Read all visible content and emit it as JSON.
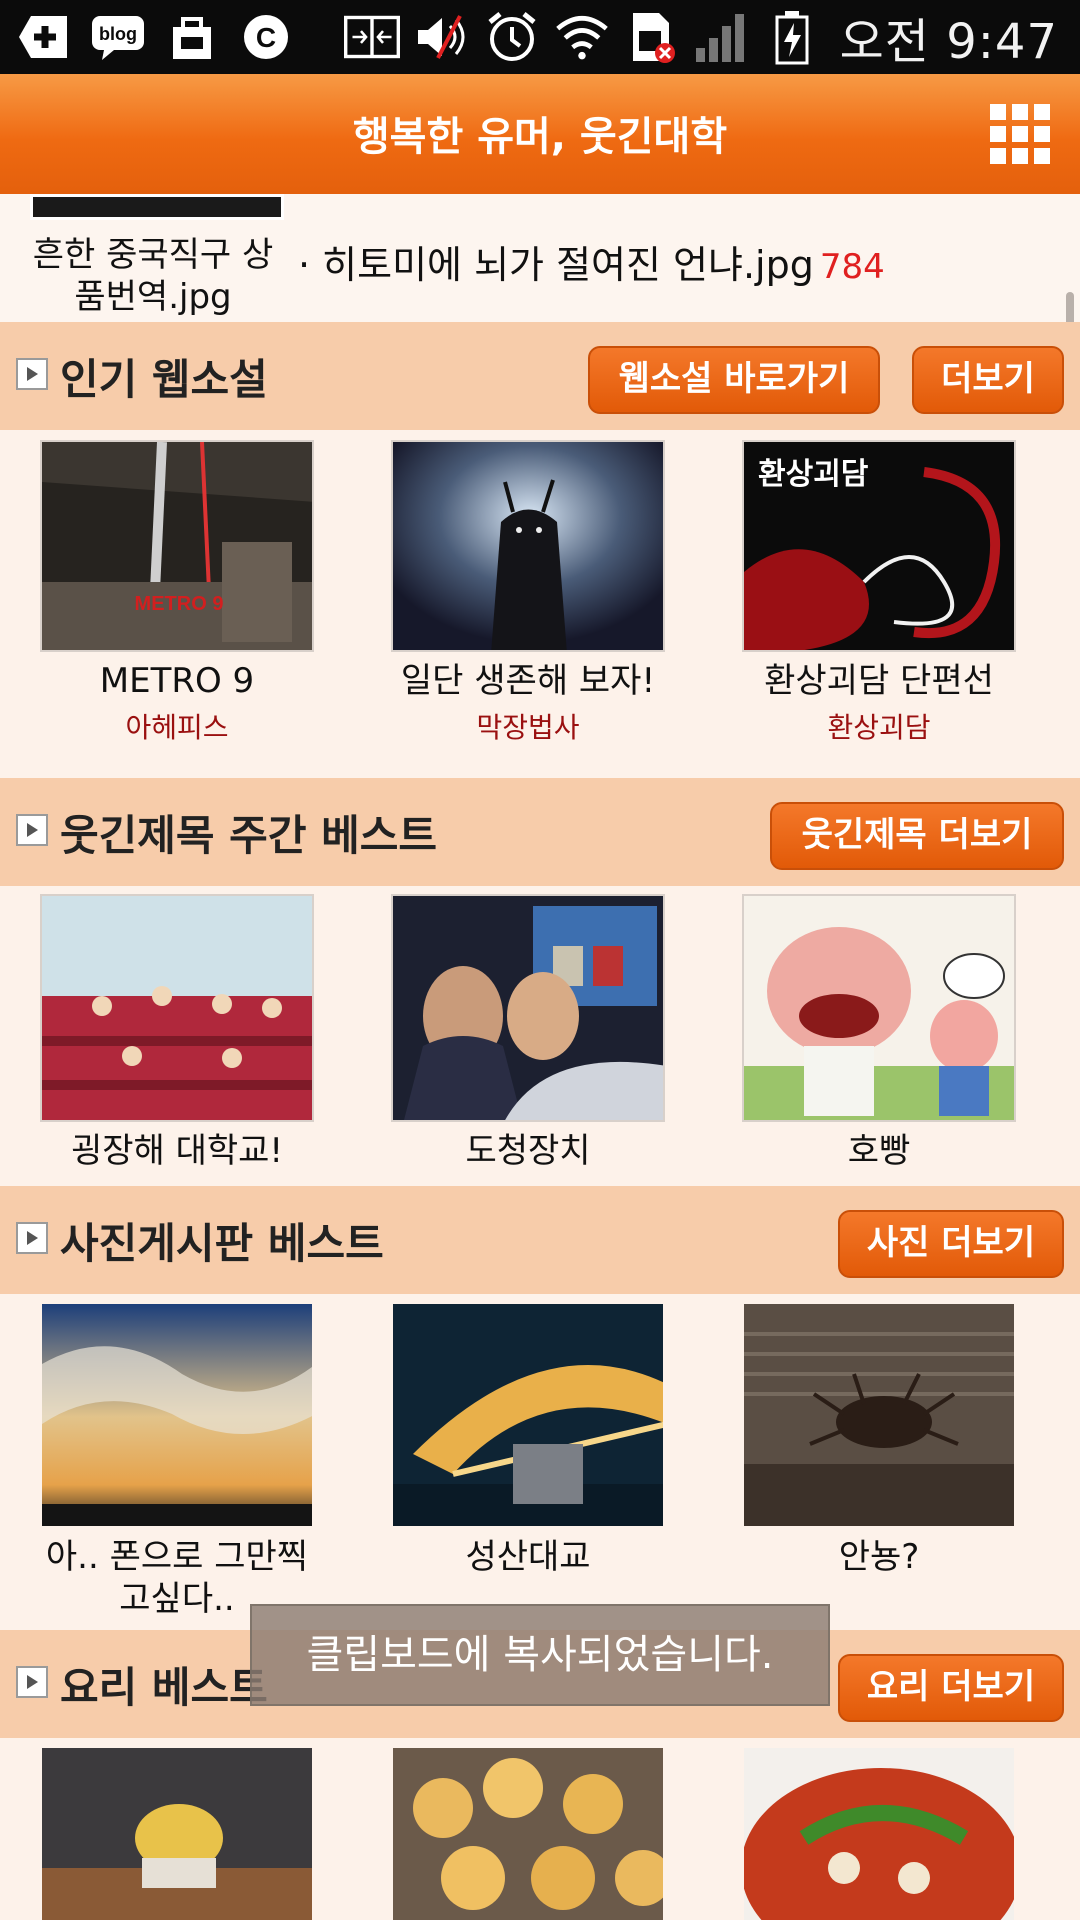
{
  "status_bar": {
    "icons_left": [
      "add-icon",
      "blog-icon",
      "bag-icon",
      "c-icon"
    ],
    "icons_right": [
      "screen-cast-icon",
      "mute-icon",
      "alarm-icon",
      "wifi-icon",
      "sim-error-icon",
      "signal-icon",
      "battery-charging-icon"
    ],
    "time": "오전 9:47"
  },
  "appbar": {
    "title": "행복한 유머, 웃긴대학"
  },
  "top_strip": {
    "left_caption": "흔한 중국직구 상품번역.jpg",
    "right_text": "· 히토미에 뇌가 절여진 언냐.jpg",
    "right_count": "784"
  },
  "sections": {
    "webnovel": {
      "title": "인기 웹소설",
      "btn_shortcut": "웹소설 바로가기",
      "btn_more": "더보기",
      "items": [
        {
          "title": "METRO 9",
          "author": "아헤피스",
          "image_text": "METRO 9"
        },
        {
          "title": "일단 생존해 보자!",
          "author": "막장법사",
          "image_text": ""
        },
        {
          "title": "환상괴담 단편선",
          "author": "환상괴담",
          "image_text": "환상괴담"
        }
      ]
    },
    "funny_titles": {
      "title": "웃긴제목 주간 베스트",
      "btn_more": "웃긴제목 더보기",
      "items": [
        {
          "title": "굉장해 대학교!"
        },
        {
          "title": "도청장치"
        },
        {
          "title": "호빵"
        }
      ]
    },
    "photos": {
      "title": "사진게시판 베스트",
      "btn_more": "사진 더보기",
      "items": [
        {
          "title": "아.. 폰으로 그만찍고싶다.."
        },
        {
          "title": "성산대교"
        },
        {
          "title": "안뇽?"
        }
      ]
    },
    "cooking": {
      "title": "요리 베스트",
      "btn_more": "요리 더보기"
    }
  },
  "toast": {
    "message": "클립보드에 복사되었습니다."
  },
  "colors": {
    "accent": "#ef6a12",
    "section_bg": "#f7ccaa",
    "author": "#9a1010",
    "count": "#e02020"
  }
}
